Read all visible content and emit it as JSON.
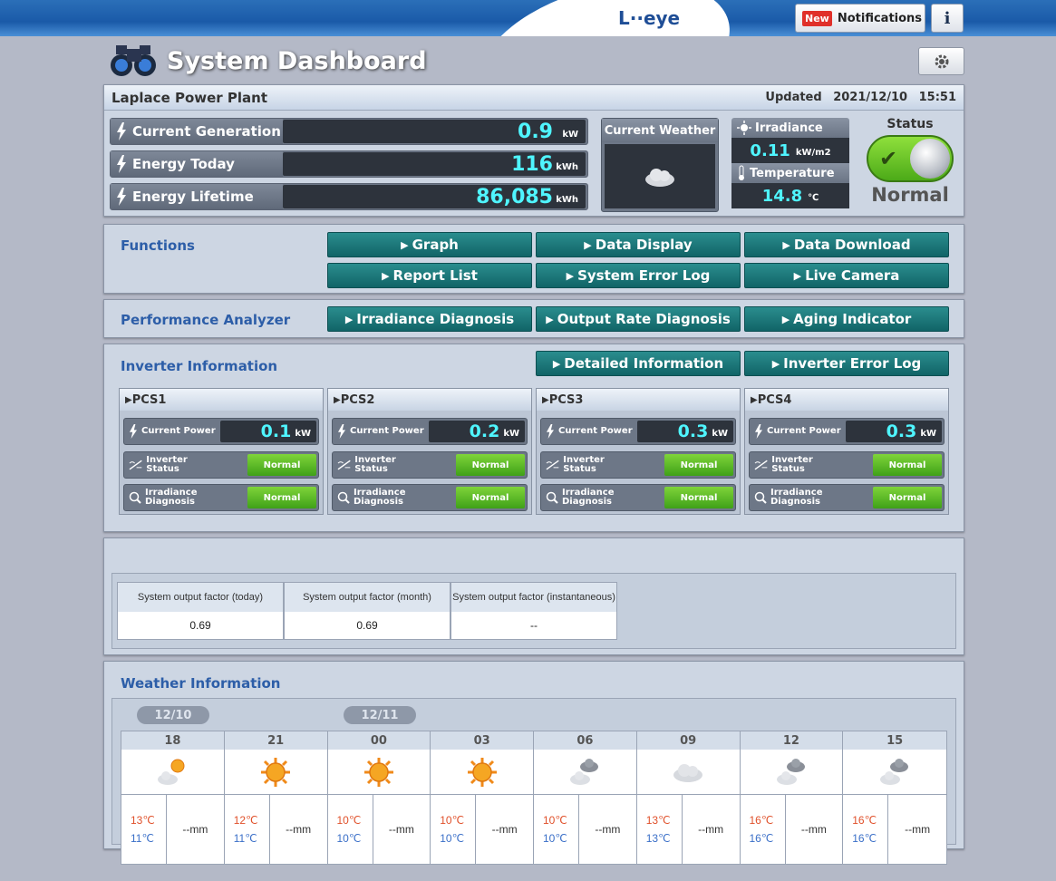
{
  "header": {
    "logo": "L··eye",
    "notif_badge": "New",
    "notif_label": "Notifications",
    "info_label": "i"
  },
  "page": {
    "title": "System Dashboard"
  },
  "plant": {
    "name": "Laplace Power Plant",
    "updated_label": "Updated",
    "updated_date": "2021/12/10",
    "updated_time": "15:51"
  },
  "generation": [
    {
      "label": "Current Generation",
      "value": "0.9",
      "unit": "kW"
    },
    {
      "label": "Energy Today",
      "value": "116",
      "unit": "kWh"
    },
    {
      "label": "Energy Lifetime",
      "value": "86,085",
      "unit": "kWh"
    }
  ],
  "weather_now": {
    "title": "Current Weather",
    "icon": "cloud-icon"
  },
  "irradiance": {
    "label": "Irradiance",
    "value": "0.11",
    "unit": "kW/m2"
  },
  "temperature": {
    "label": "Temperature",
    "value": "14.8",
    "unit": "℃"
  },
  "status": {
    "title": "Status",
    "value": "Normal",
    "color": "#5cc12a"
  },
  "functions": {
    "title": "Functions",
    "buttons": [
      "Graph",
      "Data Display",
      "Data Download",
      "Report List",
      "System Error Log",
      "Live Camera"
    ]
  },
  "analyzer": {
    "title": "Performance Analyzer",
    "buttons": [
      "Irradiance Diagnosis",
      "Output Rate Diagnosis",
      "Aging Indicator"
    ]
  },
  "inverter": {
    "title": "Inverter Information",
    "buttons": [
      "Detailed Information",
      "Inverter Error Log"
    ],
    "current_power_label": "Current Power",
    "status_label": "Inverter Status",
    "irr_label_1": "Irradiance",
    "irr_label_2": "Diagnosis",
    "units": [
      {
        "name": "PCS1",
        "power": "0.1",
        "unit": "kW",
        "status": "Normal",
        "irr": "Normal"
      },
      {
        "name": "PCS2",
        "power": "0.2",
        "unit": "kW",
        "status": "Normal",
        "irr": "Normal"
      },
      {
        "name": "PCS3",
        "power": "0.3",
        "unit": "kW",
        "status": "Normal",
        "irr": "Normal"
      },
      {
        "name": "PCS4",
        "power": "0.3",
        "unit": "kW",
        "status": "Normal",
        "irr": "Normal"
      }
    ]
  },
  "factors": [
    {
      "label": "System output factor (today)",
      "value": "0.69"
    },
    {
      "label": "System output factor (month)",
      "value": "0.69"
    },
    {
      "label": "System output factor (instantaneous)",
      "value": "--"
    }
  ],
  "weather": {
    "title": "Weather Information",
    "dates": [
      "12/10",
      "12/11"
    ],
    "slots": [
      {
        "hour": "18",
        "icon": "sun-cloud-icon",
        "hi": "13℃",
        "lo": "11℃",
        "rain": "--mm"
      },
      {
        "hour": "21",
        "icon": "sun-icon",
        "hi": "12℃",
        "lo": "11℃",
        "rain": "--mm"
      },
      {
        "hour": "00",
        "icon": "sun-icon",
        "hi": "10℃",
        "lo": "10℃",
        "rain": "--mm"
      },
      {
        "hour": "03",
        "icon": "sun-icon",
        "hi": "10℃",
        "lo": "10℃",
        "rain": "--mm"
      },
      {
        "hour": "06",
        "icon": "clouds-icon",
        "hi": "10℃",
        "lo": "10℃",
        "rain": "--mm"
      },
      {
        "hour": "09",
        "icon": "cloud-icon",
        "hi": "13℃",
        "lo": "13℃",
        "rain": "--mm"
      },
      {
        "hour": "12",
        "icon": "clouds-icon",
        "hi": "16℃",
        "lo": "16℃",
        "rain": "--mm"
      },
      {
        "hour": "15",
        "icon": "clouds-icon",
        "hi": "16℃",
        "lo": "16℃",
        "rain": "--mm"
      }
    ]
  }
}
